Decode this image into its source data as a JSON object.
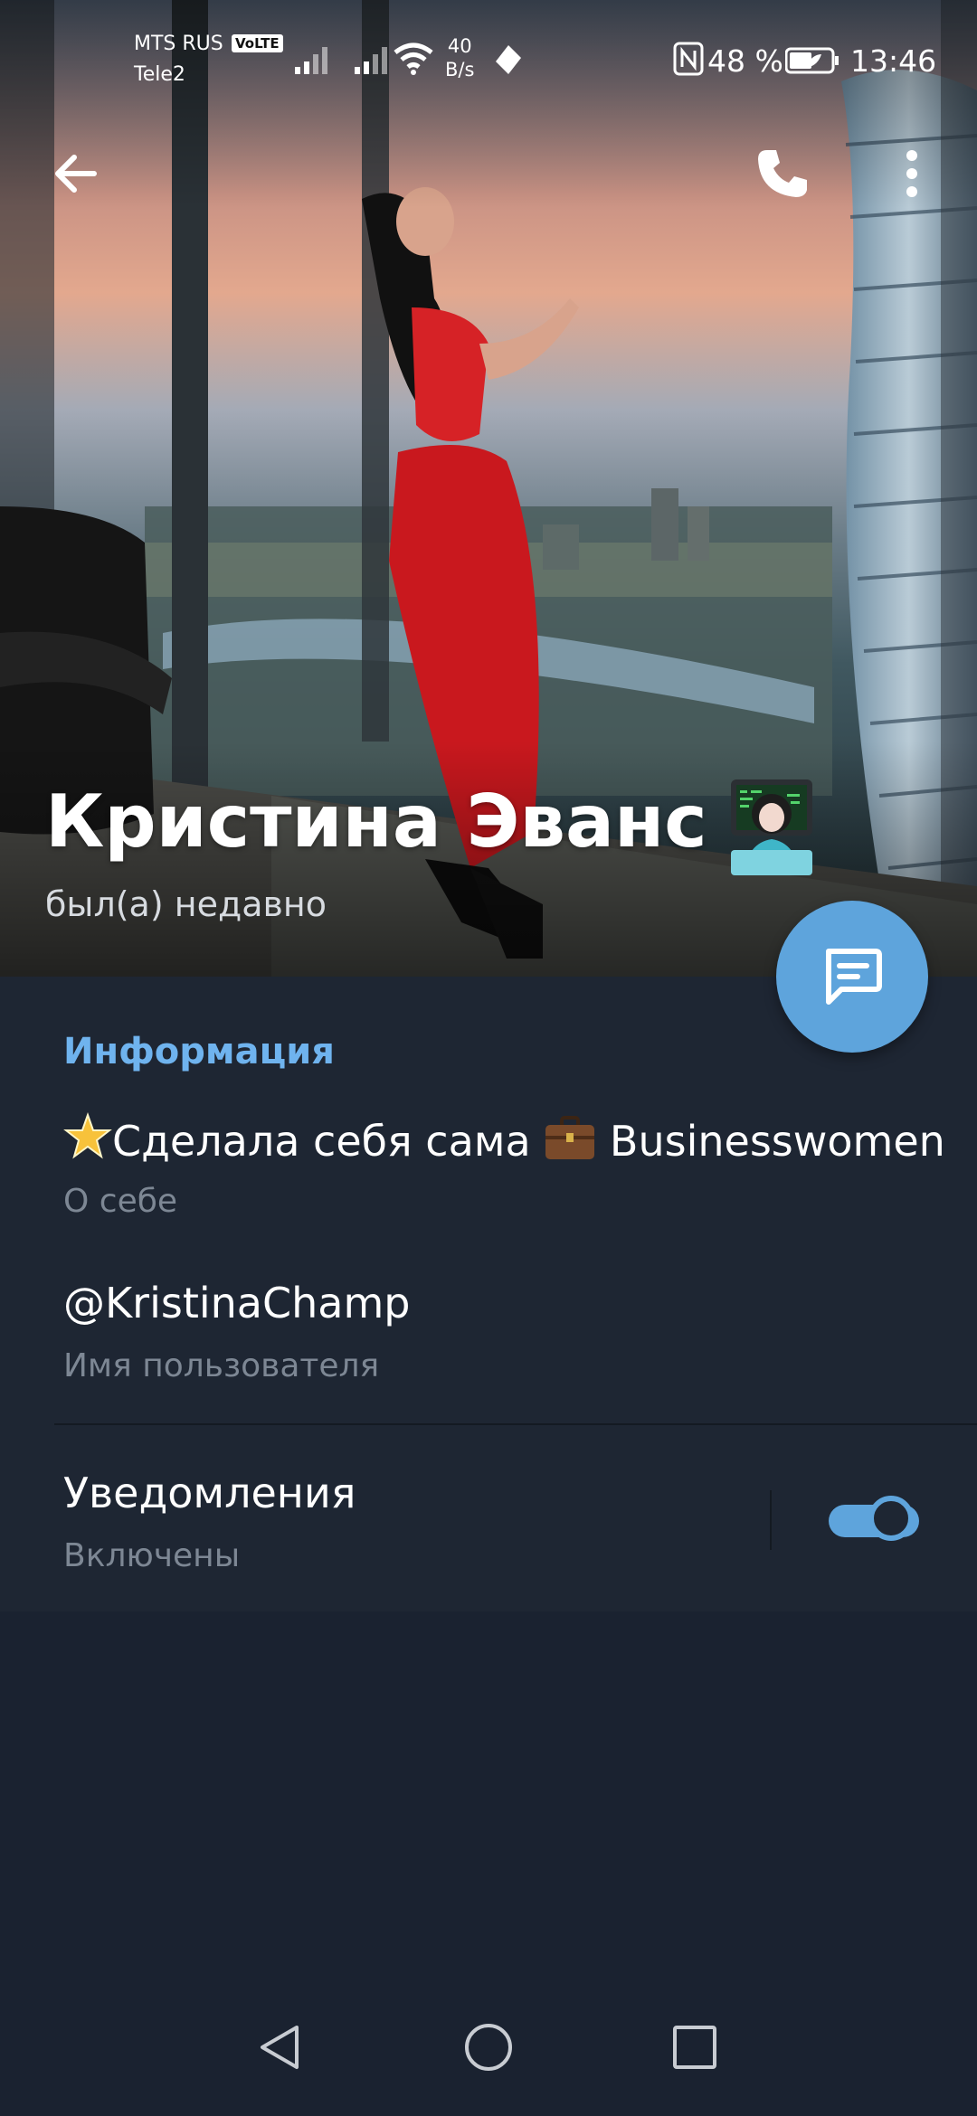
{
  "status_bar": {
    "carrier_primary": "MTS RUS",
    "volte_badge": "VoLTE",
    "carrier_secondary": "Tele2",
    "net_speed_value": "40",
    "net_speed_unit": "B/s",
    "battery_percent": "48 %",
    "time": "13:46"
  },
  "profile": {
    "name": "Кристина Эванс",
    "last_seen": "был(а) недавно"
  },
  "info": {
    "section_title": "Информация",
    "bio": "Сделала себя сама",
    "bio_suffix": "Businesswomen",
    "bio_label": "О себе",
    "username": "@KristinaChamp",
    "username_label": "Имя пользователя",
    "notifications_title": "Уведомления",
    "notifications_state": "Включены",
    "notifications_enabled": true
  },
  "icons": {
    "back": "back-arrow-icon",
    "call": "phone-icon",
    "menu": "more-vert-icon",
    "message": "message-icon",
    "nav_back": "nav-back-icon",
    "nav_home": "nav-home-icon",
    "nav_recents": "nav-recents-icon"
  },
  "colors": {
    "accent": "#5ea4dc",
    "section_title": "#6fb3ee",
    "panel_bg": "#1e2633",
    "page_bg": "#1a2230"
  }
}
